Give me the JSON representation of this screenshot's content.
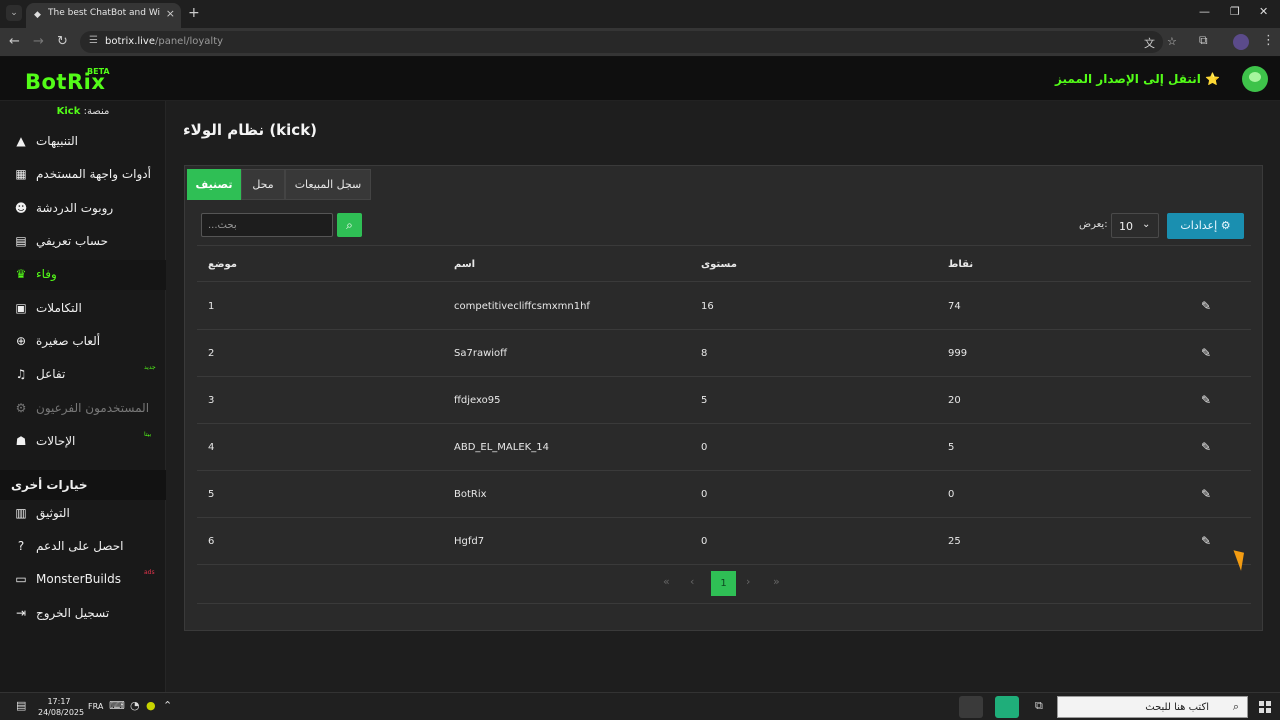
{
  "browser": {
    "tab_title": "The best ChatBot and Widgets",
    "url_host": "botrix.live",
    "url_path": "/panel/loyalty"
  },
  "header": {
    "logo": "BotRix",
    "logo_badge": "BETA",
    "premium_link": "انتقل إلى الإصدار المميز"
  },
  "sidebar": {
    "platform_label": "منصة:",
    "platform_name": "Kick",
    "items": [
      {
        "label": "التنبيهات",
        "icon": "warning-icon",
        "glyph": "▲"
      },
      {
        "label": "أدوات واجهة المستخدم",
        "icon": "widgets-icon",
        "glyph": "▦"
      },
      {
        "label": "روبوت الدردشة",
        "icon": "robot-icon",
        "glyph": "☻"
      },
      {
        "label": "حساب تعريفي",
        "icon": "id-card-icon",
        "glyph": "▤"
      },
      {
        "label": "وفاء",
        "icon": "trophy-icon",
        "glyph": "♛"
      },
      {
        "label": "التكاملات",
        "icon": "integration-icon",
        "glyph": "▣"
      },
      {
        "label": "ألعاب صغيرة",
        "icon": "gamepad-icon",
        "glyph": "⊕"
      },
      {
        "label": "تفاعل",
        "icon": "music-icon",
        "glyph": "♫",
        "badge": "جديد"
      },
      {
        "label": "المستخدمون الفرعيون",
        "icon": "users-cog-icon",
        "glyph": "⚙"
      },
      {
        "label": "الإحالات",
        "icon": "user-group-icon",
        "glyph": "☗",
        "badge": "بيتا"
      }
    ],
    "other_title": "خيارات أخرى",
    "other_items": [
      {
        "label": "التوثيق",
        "icon": "book-icon",
        "glyph": "▥"
      },
      {
        "label": "احصل على الدعم",
        "icon": "question-icon",
        "glyph": "?"
      },
      {
        "label": "MonsterBuilds",
        "icon": "laptop-icon",
        "glyph": "▭",
        "badge": "ads"
      },
      {
        "label": "تسجيل الخروج",
        "icon": "logout-icon",
        "glyph": "⇥"
      }
    ]
  },
  "main": {
    "title": "نظام الولاء (kick)",
    "tabs": [
      "تصنيف",
      "محل",
      "سجل المبيعات"
    ],
    "search_placeholder": "...بحث",
    "show_label": "يعرض:",
    "show_value": "10",
    "settings_label": "إعدادات",
    "columns": [
      "موضع",
      "اسم",
      "مستوى",
      "نقاط"
    ],
    "rows": [
      {
        "position": "1",
        "name": "competitivecliffcsmxmn1hf",
        "level": "16",
        "points": "74"
      },
      {
        "position": "2",
        "name": "Sa7rawioff",
        "level": "8",
        "points": "999"
      },
      {
        "position": "3",
        "name": "ffdjexo95",
        "level": "5",
        "points": "20"
      },
      {
        "position": "4",
        "name": "ABD_EL_MALEK_14",
        "level": "0",
        "points": "5"
      },
      {
        "position": "5",
        "name": "BotRix",
        "level": "0",
        "points": "0"
      },
      {
        "position": "6",
        "name": "Hgfd7",
        "level": "0",
        "points": "25"
      }
    ],
    "pagination": {
      "first": "«",
      "prev": "‹",
      "current": "1",
      "next": "›",
      "last": "»"
    }
  },
  "taskbar": {
    "time": "17:17",
    "date": "24/08/2025",
    "lang": "FRA",
    "search_placeholder": "اكتب هنا للبحث"
  },
  "colors": {
    "accent_green": "#53fc18",
    "button_green": "#2fbf55",
    "settings_blue": "#1a8fb0"
  }
}
